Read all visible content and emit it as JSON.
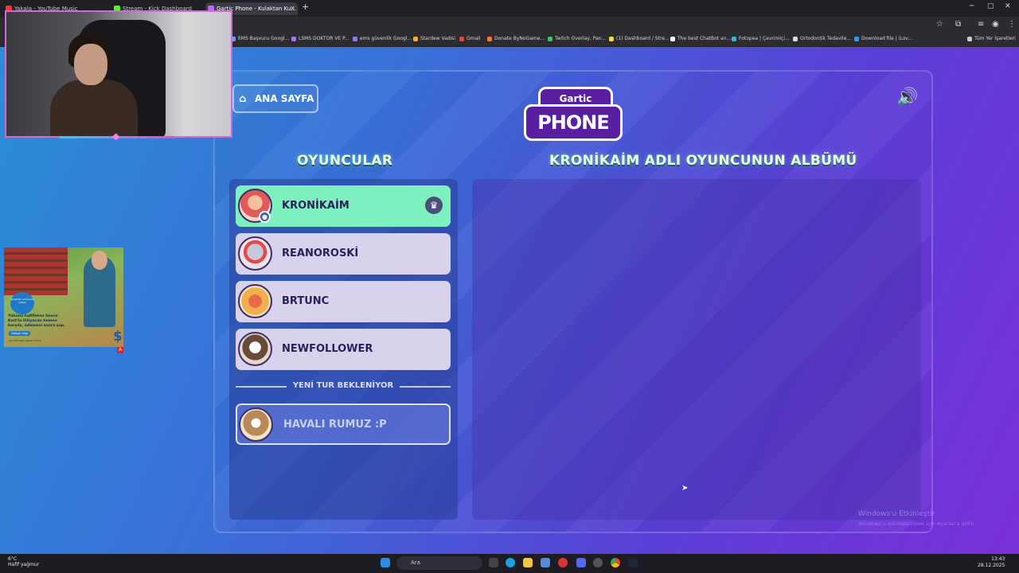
{
  "browser": {
    "tabs": [
      {
        "label": "Yakala - YouTube Music",
        "color": "#ff3333"
      },
      {
        "label": "Stream - Kick Dashboard",
        "color": "#53fc18"
      },
      {
        "label": "Gartic Phone - Kulaktan Ku...",
        "color": "#c063ff"
      }
    ],
    "new_tab": "+",
    "bookmarks": [
      {
        "label": "EMS Başvuru Googl...",
        "color": "#6e9cff"
      },
      {
        "label": "LSMS DOKTOR VE P...",
        "color": "#b06eff"
      },
      {
        "label": "ems güvenlik Googl...",
        "color": "#a06eff"
      },
      {
        "label": "Stardew Vadisi",
        "color": "#ffaa33"
      },
      {
        "label": "Gmail",
        "color": "#ea4335"
      },
      {
        "label": "Donate ByNoGame...",
        "color": "#ff7733"
      },
      {
        "label": "Twitch Overlay, Pan...",
        "color": "#33cc66"
      },
      {
        "label": "(1) Dashboard / Stre...",
        "color": "#ffd633"
      },
      {
        "label": "The best ChatBot an...",
        "color": "#ffffff"
      },
      {
        "label": "Fotopea | Çevrimiçi...",
        "color": "#33bbdd"
      },
      {
        "label": "Ortodontik Tedavile...",
        "color": "#dddddd"
      },
      {
        "label": "Download file | iLov...",
        "color": "#3399ff"
      }
    ],
    "all_bookmarks": "Tüm Yer İşaretleri"
  },
  "game": {
    "home_label": "ANA SAYFA",
    "logo_top": "Gartic",
    "logo_main": "PHONE",
    "players_title": "OYUNCULAR",
    "album_title": "KRONİKAİM ADLI OYUNCUNUN ALBÜMÜ",
    "players": [
      {
        "name": "KRONİKAİM"
      },
      {
        "name": "REANOROSKİ"
      },
      {
        "name": "BRTUNC"
      },
      {
        "name": "NEWFOLLOWER"
      }
    ],
    "waiting_label": "YENİ TUR BEKLENİYOR",
    "spectator": "HAVALI RUMUZ :P"
  },
  "ad": {
    "bubble": "İşCep'ten ürünlerde imkan",
    "text": "Yükünü hafifleten İmece Kart'la ihtiyacını hemen karşıla, ödemeni sonra yap.",
    "button": "Detaylı bilgi",
    "footer": "Ayrıntılı bilgi: isbank.com.tr"
  },
  "watermark": {
    "title": "Windows'u Etkinleştir",
    "subtitle": "Windows'u etkinleştirmek için Ayarlar'a gidin."
  },
  "taskbar": {
    "temp": "6°C",
    "weather": "Hafif yağmur",
    "search": "Ara",
    "time": "13:43",
    "date": "28.12.2025"
  }
}
